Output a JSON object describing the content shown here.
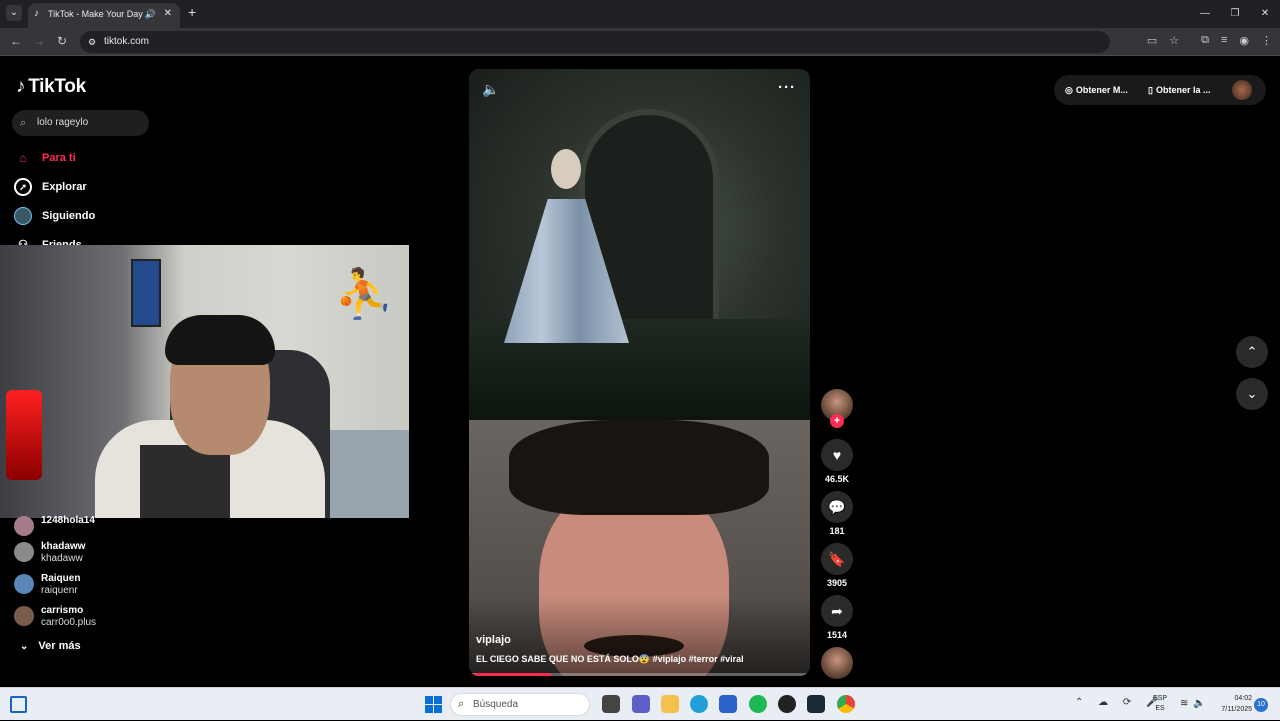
{
  "browser": {
    "tab_title": "TikTok - Make Your Day",
    "url": "tiktok.com"
  },
  "sidebar": {
    "logo": "TikTok",
    "search_value": "lolo rageylo",
    "nav": [
      {
        "label": "Para ti",
        "icon": "home-icon",
        "active": true
      },
      {
        "label": "Explorar",
        "icon": "compass-icon",
        "active": false
      },
      {
        "label": "Siguiendo",
        "icon": "following-avatar-icon",
        "active": false
      },
      {
        "label": "Friends",
        "icon": "friends-icon",
        "active": false
      }
    ],
    "following": [
      {
        "name": "",
        "handle": "1248hola14"
      },
      {
        "name": "khadaww",
        "handle": "khadaww"
      },
      {
        "name": "Raiquen",
        "handle": "raiquenr"
      },
      {
        "name": "carrismo",
        "handle": "carr0o0.plus"
      }
    ],
    "see_more": "Ver más"
  },
  "video": {
    "username": "viplajo",
    "caption": "EL CIEGO SABE QUE NO ESTÁ SOLO😨 #viplajo #terror #viral",
    "progress": 0.24
  },
  "actions": {
    "likes": "46.5K",
    "comments": "181",
    "saves": "3905",
    "shares": "1514"
  },
  "topbar": {
    "get_coins": "Obtener M...",
    "get_app": "Obtener la ..."
  },
  "taskbar": {
    "search_placeholder": "Búsqueda",
    "lang_top": "ESP",
    "lang_bottom": "ES",
    "time": "04:02",
    "date": "7/11/2025",
    "notifications": "10"
  },
  "colors": {
    "accent": "#fe2c55",
    "background": "#000000",
    "taskbar": "#e9eef4"
  }
}
